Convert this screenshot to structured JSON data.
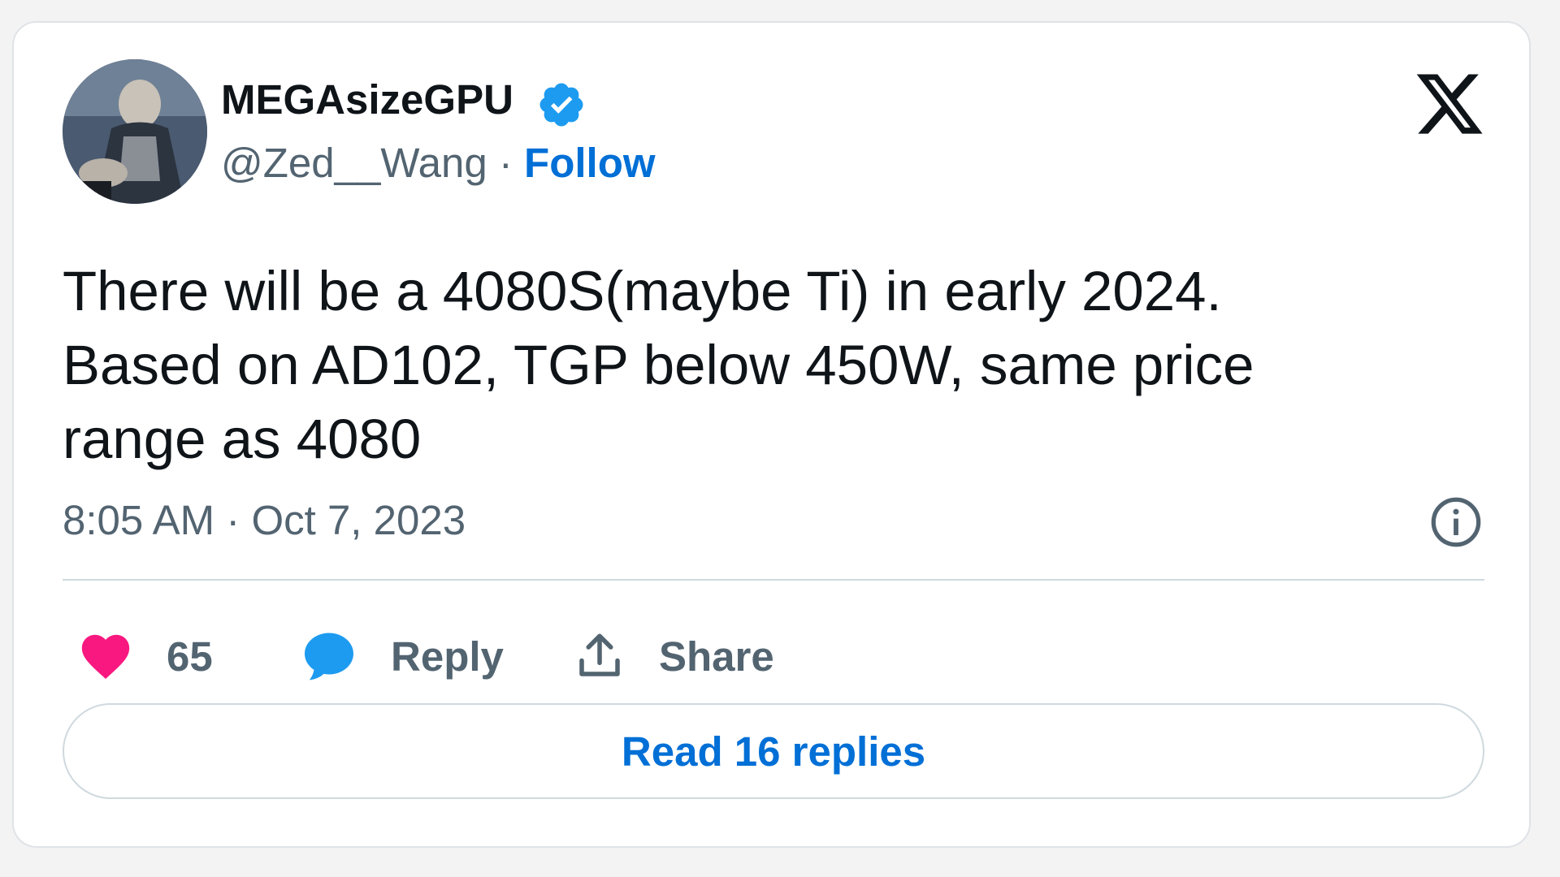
{
  "author": {
    "display_name": "MEGAsizeGPU",
    "handle": "@Zed__Wang",
    "separator": " · ",
    "follow_label": "Follow",
    "verified": true
  },
  "tweet": {
    "text": "There will be a 4080S(maybe Ti) in early 2024.\nBased on AD102, TGP below 450W, same price\nrange as 4080",
    "timestamp": "8:05 AM · Oct 7, 2023"
  },
  "actions": {
    "like_count": "65",
    "reply_label": "Reply",
    "share_label": "Share"
  },
  "read_replies_label": "Read 16 replies",
  "icons": {
    "brand": "x-logo-icon",
    "verified": "verified-badge-icon",
    "info": "info-icon",
    "like": "heart-icon",
    "reply": "speech-bubble-icon",
    "share": "share-upload-icon"
  },
  "colors": {
    "link": "#006fd6",
    "verified": "#1d9bf0",
    "heart": "#f91880",
    "text_primary": "#0f1419",
    "text_secondary": "#536471",
    "border": "#cfd9de"
  }
}
